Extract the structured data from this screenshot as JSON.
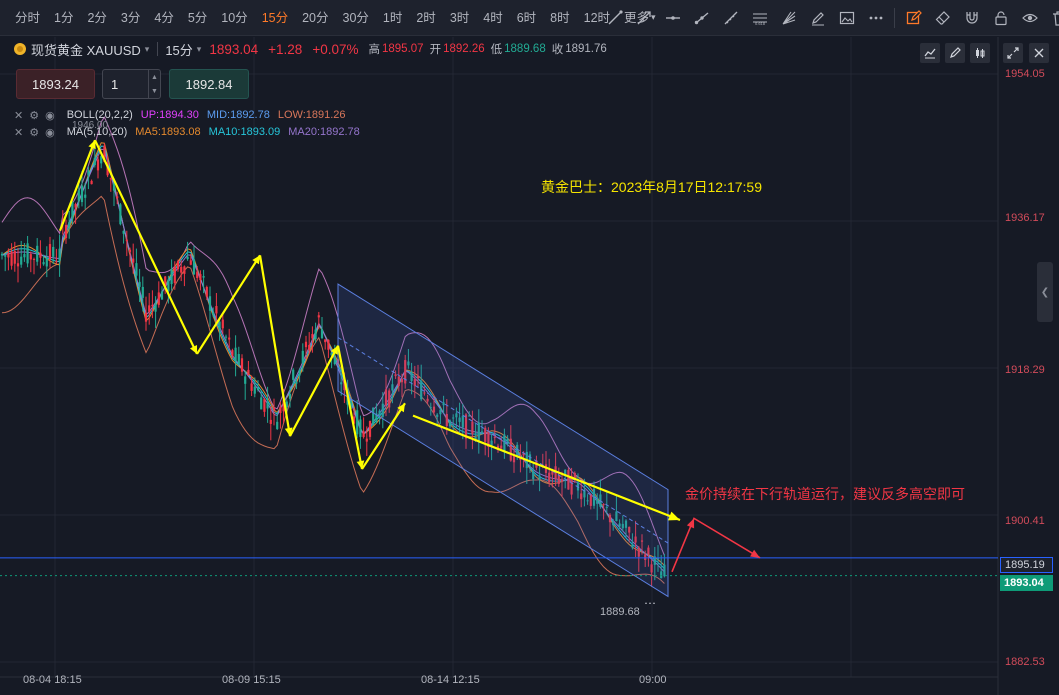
{
  "toolbar": {
    "intervals": [
      "分时",
      "1分",
      "2分",
      "3分",
      "4分",
      "5分",
      "10分",
      "15分",
      "20分",
      "30分",
      "1时",
      "2时",
      "3时",
      "4时",
      "6时",
      "8时",
      "12时",
      "更多"
    ],
    "active_interval": "15分",
    "more_caret": "▾",
    "tools": [
      "trend-line-icon",
      "arrow-line-icon",
      "horizontal-line-icon",
      "ray-icon",
      "fib-icon",
      "fib-retrace-icon",
      "fan-icon",
      "brush-icon",
      "image-icon",
      "more-dots-icon",
      "edit-icon",
      "eraser-icon",
      "magnet-icon",
      "lock-icon",
      "eye-icon",
      "trash-icon"
    ]
  },
  "symbol": {
    "name": "现货黄金 XAUUSD",
    "interval": "15分",
    "caret": "▾",
    "price": "1893.04",
    "change": "+1.28",
    "change_pct": "+0.07%",
    "high_label": "高",
    "high": "1895.07",
    "open_label": "开",
    "open": "1892.26",
    "low_label": "低",
    "low": "1889.68",
    "close_label": "收",
    "close": "1891.76"
  },
  "order": {
    "sell_price": "1893.24",
    "quantity": "1",
    "buy_price": "1892.84"
  },
  "indicators": {
    "boll": {
      "name": "BOLL(20,2,2)",
      "up": "UP:1894.30",
      "mid": "MID:1892.78",
      "low": "LOW:1891.26"
    },
    "ma": {
      "name": "MA(5,10,20)",
      "ma5": "MA5:1893.08",
      "ma10": "MA10:1893.09",
      "ma20": "MA20:1892.78"
    }
  },
  "price_axis": {
    "labels": [
      "1954.05",
      "1936.17",
      "1918.29",
      "1900.41",
      "1882.53"
    ],
    "line_tag": "1895.19",
    "last_tag": "1893.04"
  },
  "time_axis": {
    "labels": [
      "08-04 18:15",
      "08-09 15:15",
      "08-14 12:15",
      "09:00"
    ]
  },
  "annotations": {
    "watermark": "黄金巴士：2023年8月17日12:17:59",
    "forecast": "金价持续在下行轨道运行，建议反多高空即可",
    "low_marker": "1889.68",
    "high_marker": "1946.00"
  },
  "colors": {
    "up": "#f23645",
    "down": "#22ab94",
    "boll": "#c77dc4",
    "ma5": "#e4892e",
    "ma10": "#26c6da",
    "ma20": "#9575cd",
    "channel": "#5b7fe0",
    "arrow": "#ffff00",
    "forecast_arrow": "#f23645",
    "watermark": "#f5e400"
  },
  "chart_data": {
    "type": "candlestick",
    "symbol": "XAUUSD",
    "interval": "15分",
    "ylim": [
      1882.53,
      1954.05
    ],
    "y_ticks": [
      1954.05,
      1936.17,
      1918.29,
      1900.41,
      1882.53
    ],
    "x_ticks": [
      "08-04 18:15",
      "08-09 15:15",
      "08-14 12:15",
      "09:00"
    ],
    "path_points": [
      {
        "t": "08-04 18:15",
        "close": 1934
      },
      {
        "t": "08-06",
        "close": 1945
      },
      {
        "t": "08-08",
        "close": 1925
      },
      {
        "t": "08-09 12:00",
        "close": 1932
      },
      {
        "t": "08-09 15:15",
        "close": 1920
      },
      {
        "t": "08-10",
        "close": 1912
      },
      {
        "t": "08-10 12:00",
        "close": 1924
      },
      {
        "t": "08-11",
        "close": 1910
      },
      {
        "t": "08-11 12:00",
        "close": 1918
      },
      {
        "t": "08-14",
        "close": 1912
      },
      {
        "t": "08-14 12:15",
        "close": 1910
      },
      {
        "t": "08-15",
        "close": 1906
      },
      {
        "t": "08-16",
        "close": 1904
      },
      {
        "t": "08-16 12:00",
        "close": 1899
      },
      {
        "t": "09:00",
        "close": 1893
      }
    ],
    "grid": true,
    "horizontal_line": 1895.19,
    "last_price": 1893.04,
    "extreme_low": 1889.68
  }
}
